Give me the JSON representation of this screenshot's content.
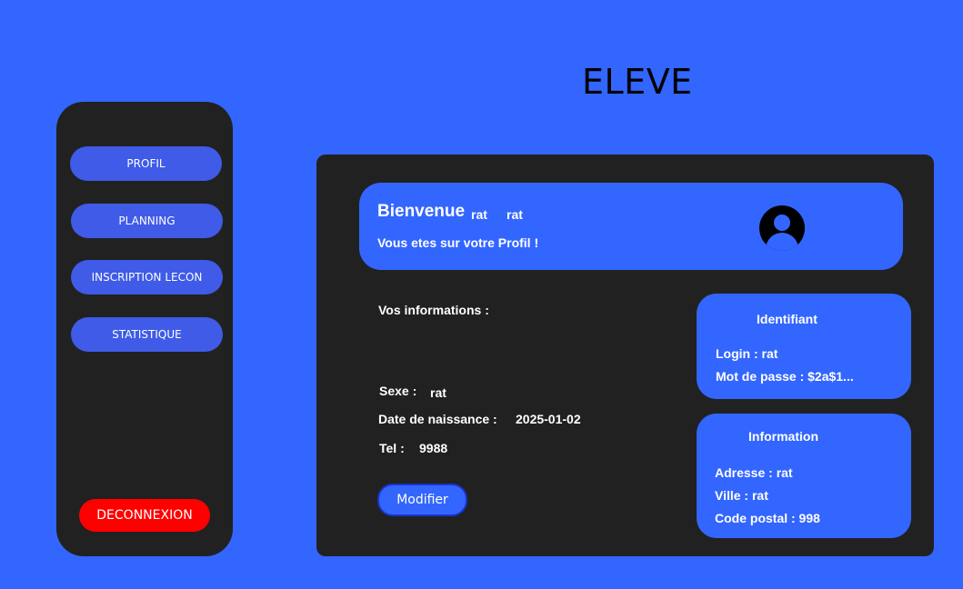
{
  "page": {
    "title": "ELEVE"
  },
  "sidebar": {
    "items": [
      {
        "label": "PROFIL"
      },
      {
        "label": "PLANNING"
      },
      {
        "label": "INSCRIPTION LECON"
      },
      {
        "label": "STATISTIQUE"
      }
    ],
    "logout_label": "DECONNEXION"
  },
  "welcome": {
    "title": "Bienvenue",
    "first_name": "rat",
    "last_name": "rat",
    "subtitle": "Vous etes sur votre Profil !"
  },
  "info": {
    "heading": "Vos informations :",
    "sexe_label": "Sexe :",
    "sexe_value": "rat",
    "birth_label": "Date de naissance :",
    "birth_value": "2025-01-02",
    "tel_label": "Tel :",
    "tel_value": "9988",
    "modify_label": "Modifier"
  },
  "identifiant_card": {
    "title": "Identifiant",
    "login": "Login : rat",
    "password": "Mot de passe : $2a$1..."
  },
  "information_card": {
    "title": "Information",
    "address": "Adresse : rat",
    "city": "Ville : rat",
    "postal": "Code postal : 998"
  },
  "colors": {
    "background": "#3366ff",
    "panel": "#212121",
    "nav_button": "#3f5be8",
    "logout": "#ff0000"
  }
}
